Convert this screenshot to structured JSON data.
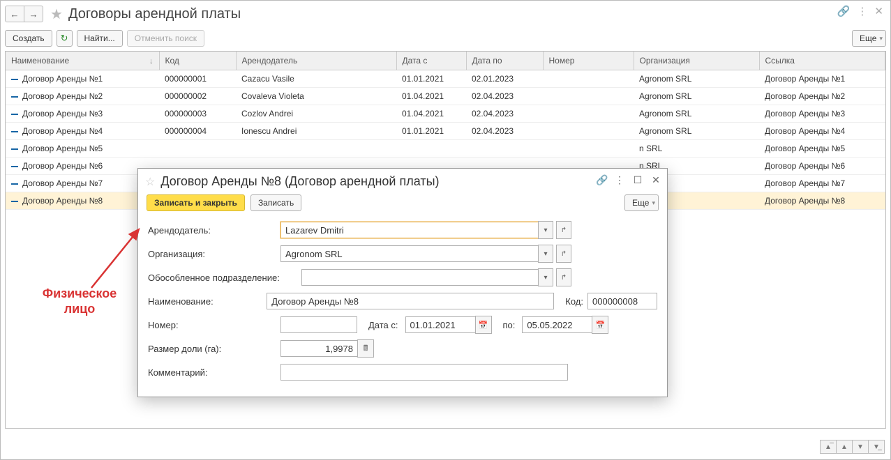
{
  "page": {
    "title": "Договоры арендной платы"
  },
  "toolbar": {
    "create": "Создать",
    "find": "Найти...",
    "cancel_find": "Отменить поиск",
    "more": "Еще"
  },
  "columns": {
    "name": "Наименование",
    "code": "Код",
    "lessor": "Арендодатель",
    "date_from": "Дата с",
    "date_to": "Дата по",
    "number": "Номер",
    "org": "Организация",
    "link": "Ссылка"
  },
  "rows": [
    {
      "name": "Договор Аренды №1",
      "code": "000000001",
      "lessor": "Cazacu Vasile",
      "date_from": "01.01.2021",
      "date_to": "02.01.2023",
      "number": "",
      "org": "Agronom SRL",
      "link": "Договор Аренды №1"
    },
    {
      "name": "Договор Аренды №2",
      "code": "000000002",
      "lessor": "Covaleva Violeta",
      "date_from": "01.04.2021",
      "date_to": "02.04.2023",
      "number": "",
      "org": "Agronom SRL",
      "link": "Договор Аренды №2"
    },
    {
      "name": "Договор Аренды №3",
      "code": "000000003",
      "lessor": "Cozlov Andrei",
      "date_from": "01.04.2021",
      "date_to": "02.04.2023",
      "number": "",
      "org": "Agronom SRL",
      "link": "Договор Аренды №3"
    },
    {
      "name": "Договор Аренды №4",
      "code": "000000004",
      "lessor": "Ionescu Andrei",
      "date_from": "01.01.2021",
      "date_to": "02.04.2023",
      "number": "",
      "org": "Agronom SRL",
      "link": "Договор Аренды №4"
    },
    {
      "name": "Договор Аренды №5",
      "code": "",
      "lessor": "",
      "date_from": "",
      "date_to": "",
      "number": "",
      "org": "n SRL",
      "link": "Договор Аренды №5"
    },
    {
      "name": "Договор Аренды №6",
      "code": "",
      "lessor": "",
      "date_from": "",
      "date_to": "",
      "number": "",
      "org": "n SRL",
      "link": "Договор Аренды №6"
    },
    {
      "name": "Договор Аренды №7",
      "code": "",
      "lessor": "",
      "date_from": "",
      "date_to": "",
      "number": "",
      "org": "n SRL",
      "link": "Договор Аренды №7"
    },
    {
      "name": "Договор Аренды №8",
      "code": "",
      "lessor": "",
      "date_from": "",
      "date_to": "",
      "number": "",
      "org": "n SRL",
      "link": "Договор Аренды №8",
      "selected": true
    }
  ],
  "dialog": {
    "title": "Договор Аренды №8 (Договор арендной платы)",
    "save_close": "Записать и закрыть",
    "save": "Записать",
    "more": "Еще",
    "labels": {
      "lessor": "Арендодатель:",
      "org": "Организация:",
      "unit": "Обособленное подразделение:",
      "name": "Наименование:",
      "number": "Номер:",
      "date_from": "Дата с:",
      "date_to": "по:",
      "share": "Размер доли (га):",
      "comment": "Комментарий:",
      "code": "Код:"
    },
    "values": {
      "lessor": "Lazarev Dmitri",
      "org": "Agronom SRL",
      "unit": "",
      "name": "Договор Аренды №8",
      "number": "",
      "date_from": "01.01.2021",
      "date_to": "05.05.2022",
      "share": "1,9978",
      "comment": "",
      "code": "000000008"
    }
  },
  "annotation": {
    "text1": "Физическое",
    "text2": "лицо"
  }
}
